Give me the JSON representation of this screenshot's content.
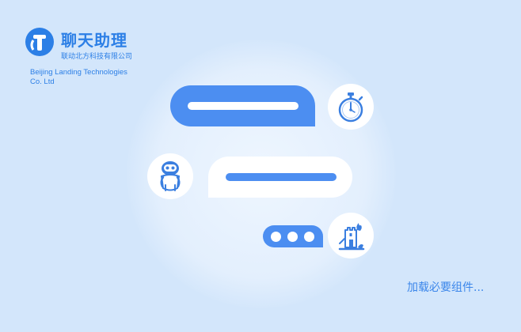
{
  "brand": {
    "title": "聊天助理",
    "subtitle": "联动北方科技有限公司",
    "company_line1": "Beijing Landing Technologies",
    "company_line2": "Co. Ltd"
  },
  "status": {
    "loading_text": "加载必要组件..."
  },
  "colors": {
    "background": "#d3e6fb",
    "accent": "#4c8ef1",
    "brand_text": "#2c7fe6"
  },
  "icons": [
    "logo-icon",
    "stopwatch-icon",
    "robot-icon",
    "castle-fire-icon"
  ]
}
